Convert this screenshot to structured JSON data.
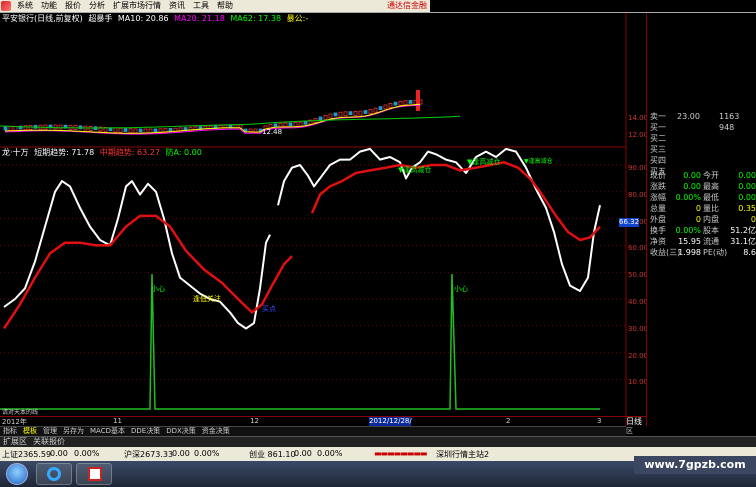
{
  "menu": {
    "items": [
      "系统",
      "功能",
      "报价",
      "分析",
      "扩展市场行情",
      "资讯",
      "工具",
      "帮助"
    ],
    "broker_label": "通达信金融终"
  },
  "upper_legend": {
    "title": "平安银行(日线,前复权)",
    "indicator": "超暴手",
    "ma10": "MA10: 20.86",
    "ma20": "MA20: 21.18",
    "ma62": "MA62: 17.38",
    "extra": "暴公:-"
  },
  "lower_legend": {
    "name": "龙·十万",
    "short_trend": "短期趋势: 71.78",
    "mid_trend": "中期趋势: 63.27",
    "lure": "防A: 0.00"
  },
  "upper_ticks": [
    "14.00",
    "12.00"
  ],
  "low_price_label": "12.48",
  "lower_ticks": [
    "90.00",
    "80.00",
    "70.00",
    "60.00",
    "50.00",
    "40.00",
    "30.00",
    "20.00",
    "10.00"
  ],
  "current_value": "66.32",
  "annotations": {
    "caution1": "小心",
    "caution2": "小心",
    "attention": "逢低关注",
    "buy": "买点",
    "high1": "▼逢高减仓",
    "high2": "▼逢高减仓",
    "high3": "▼逢高减仓"
  },
  "x_axis": {
    "start_label": "2012年",
    "labels": [
      "11",
      "12",
      "2",
      "3"
    ],
    "highlight_date": "2012/12/28/五"
  },
  "bottom_notes": "请对天本的线",
  "info_panel": {
    "orders": [
      {
        "label": "卖一",
        "price": "23.00",
        "vol": "1163"
      },
      {
        "label": "买一",
        "price": "",
        "vol": "948"
      },
      {
        "label": "买二",
        "price": "",
        "vol": ""
      },
      {
        "label": "买三",
        "price": "",
        "vol": ""
      },
      {
        "label": "买四",
        "price": "",
        "vol": ""
      },
      {
        "label": "买五",
        "price": "",
        "vol": ""
      }
    ],
    "stats": [
      {
        "l1": "现价",
        "v1": "0.00",
        "l2": "今开",
        "v2": "0.00"
      },
      {
        "l1": "涨跌",
        "v1": "0.00",
        "l2": "最高",
        "v2": "0.00"
      },
      {
        "l1": "涨幅",
        "v1": "0.00%",
        "l2": "最低",
        "v2": "0.00"
      },
      {
        "l1": "总量",
        "v1": "0",
        "l2": "量比",
        "v2": "0.35"
      },
      {
        "l1": "外盘",
        "v1": "0",
        "l2": "内盘",
        "v2": "0"
      },
      {
        "l1": "换手",
        "v1": "0.00%",
        "l2": "股本",
        "v2": "51.2亿"
      },
      {
        "l1": "净资",
        "v1": "15.95",
        "l2": "流通",
        "v2": "31.1亿"
      },
      {
        "l1": "收益(三)",
        "v1": "1.998",
        "l2": "PE(动)",
        "v2": "8.6"
      }
    ]
  },
  "period": {
    "label": "日线",
    "tab": "区"
  },
  "toolbar": [
    "指标",
    "模板",
    "管理",
    "另存为",
    "MACD基本",
    "DDE决策",
    "DDX决策",
    "资金决策"
  ],
  "tabs": [
    "扩展区",
    "关联报价"
  ],
  "status": {
    "sh_index": "上证2365.59",
    "sh_change": "0.00",
    "sh_pct": "0.00%",
    "hs_index": "沪深2673.33",
    "hs_change": "0.00",
    "hs_pct": "0.00%",
    "cy_index": "创业 861.10",
    "cy_change": "0.00",
    "cy_pct": "0.00%",
    "server": "深圳行情主站2"
  },
  "watermark": "www.7gpzb.com",
  "colors": {
    "short_trend": "#ffffff",
    "mid_trend": "#e01010",
    "signal": "#20c020",
    "border": "#8a0000"
  }
}
